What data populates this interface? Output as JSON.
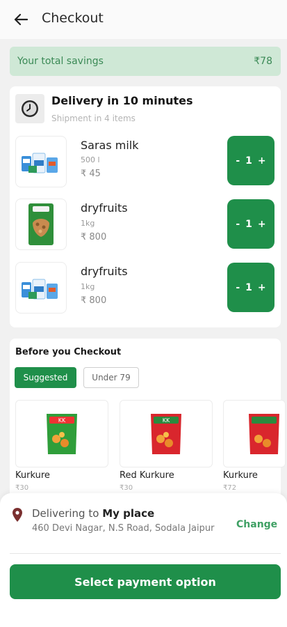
{
  "header": {
    "title": "Checkout"
  },
  "savings": {
    "label": "Your total savings",
    "amount": "₹78"
  },
  "delivery": {
    "title": "Delivery in 10 minutes",
    "subtitle": "Shipment in 4 items",
    "items": [
      {
        "name": "Saras milk",
        "qty": "500 l",
        "price": "₹ 45",
        "stepper": {
          "minus": "-",
          "count": "1",
          "plus": "+"
        }
      },
      {
        "name": "dryfruits",
        "qty": "1kg",
        "price": "₹ 800",
        "stepper": {
          "minus": "-",
          "count": "1",
          "plus": "+"
        }
      },
      {
        "name": "dryfruits",
        "qty": "1kg",
        "price": "₹ 800",
        "stepper": {
          "minus": "-",
          "count": "1",
          "plus": "+"
        }
      }
    ]
  },
  "before_checkout": {
    "title": "Before you Checkout",
    "tabs": [
      "Suggested",
      "Under 79"
    ],
    "products": [
      {
        "name": "Kurkure",
        "price": "₹30"
      },
      {
        "name": "Red Kurkure",
        "price": "₹30"
      },
      {
        "name": "Kurkure",
        "price": "₹72"
      }
    ]
  },
  "address": {
    "prefix": "Delivering to",
    "place": "My place",
    "line": "460 Devi Nagar, N.S Road, Sodala Jaipur",
    "change_label": "Change"
  },
  "payment": {
    "button_label": "Select payment option"
  },
  "colors": {
    "accent": "#1f8f4a",
    "savings_bg": "#cfe8d6",
    "savings_text": "#3b8a56"
  }
}
